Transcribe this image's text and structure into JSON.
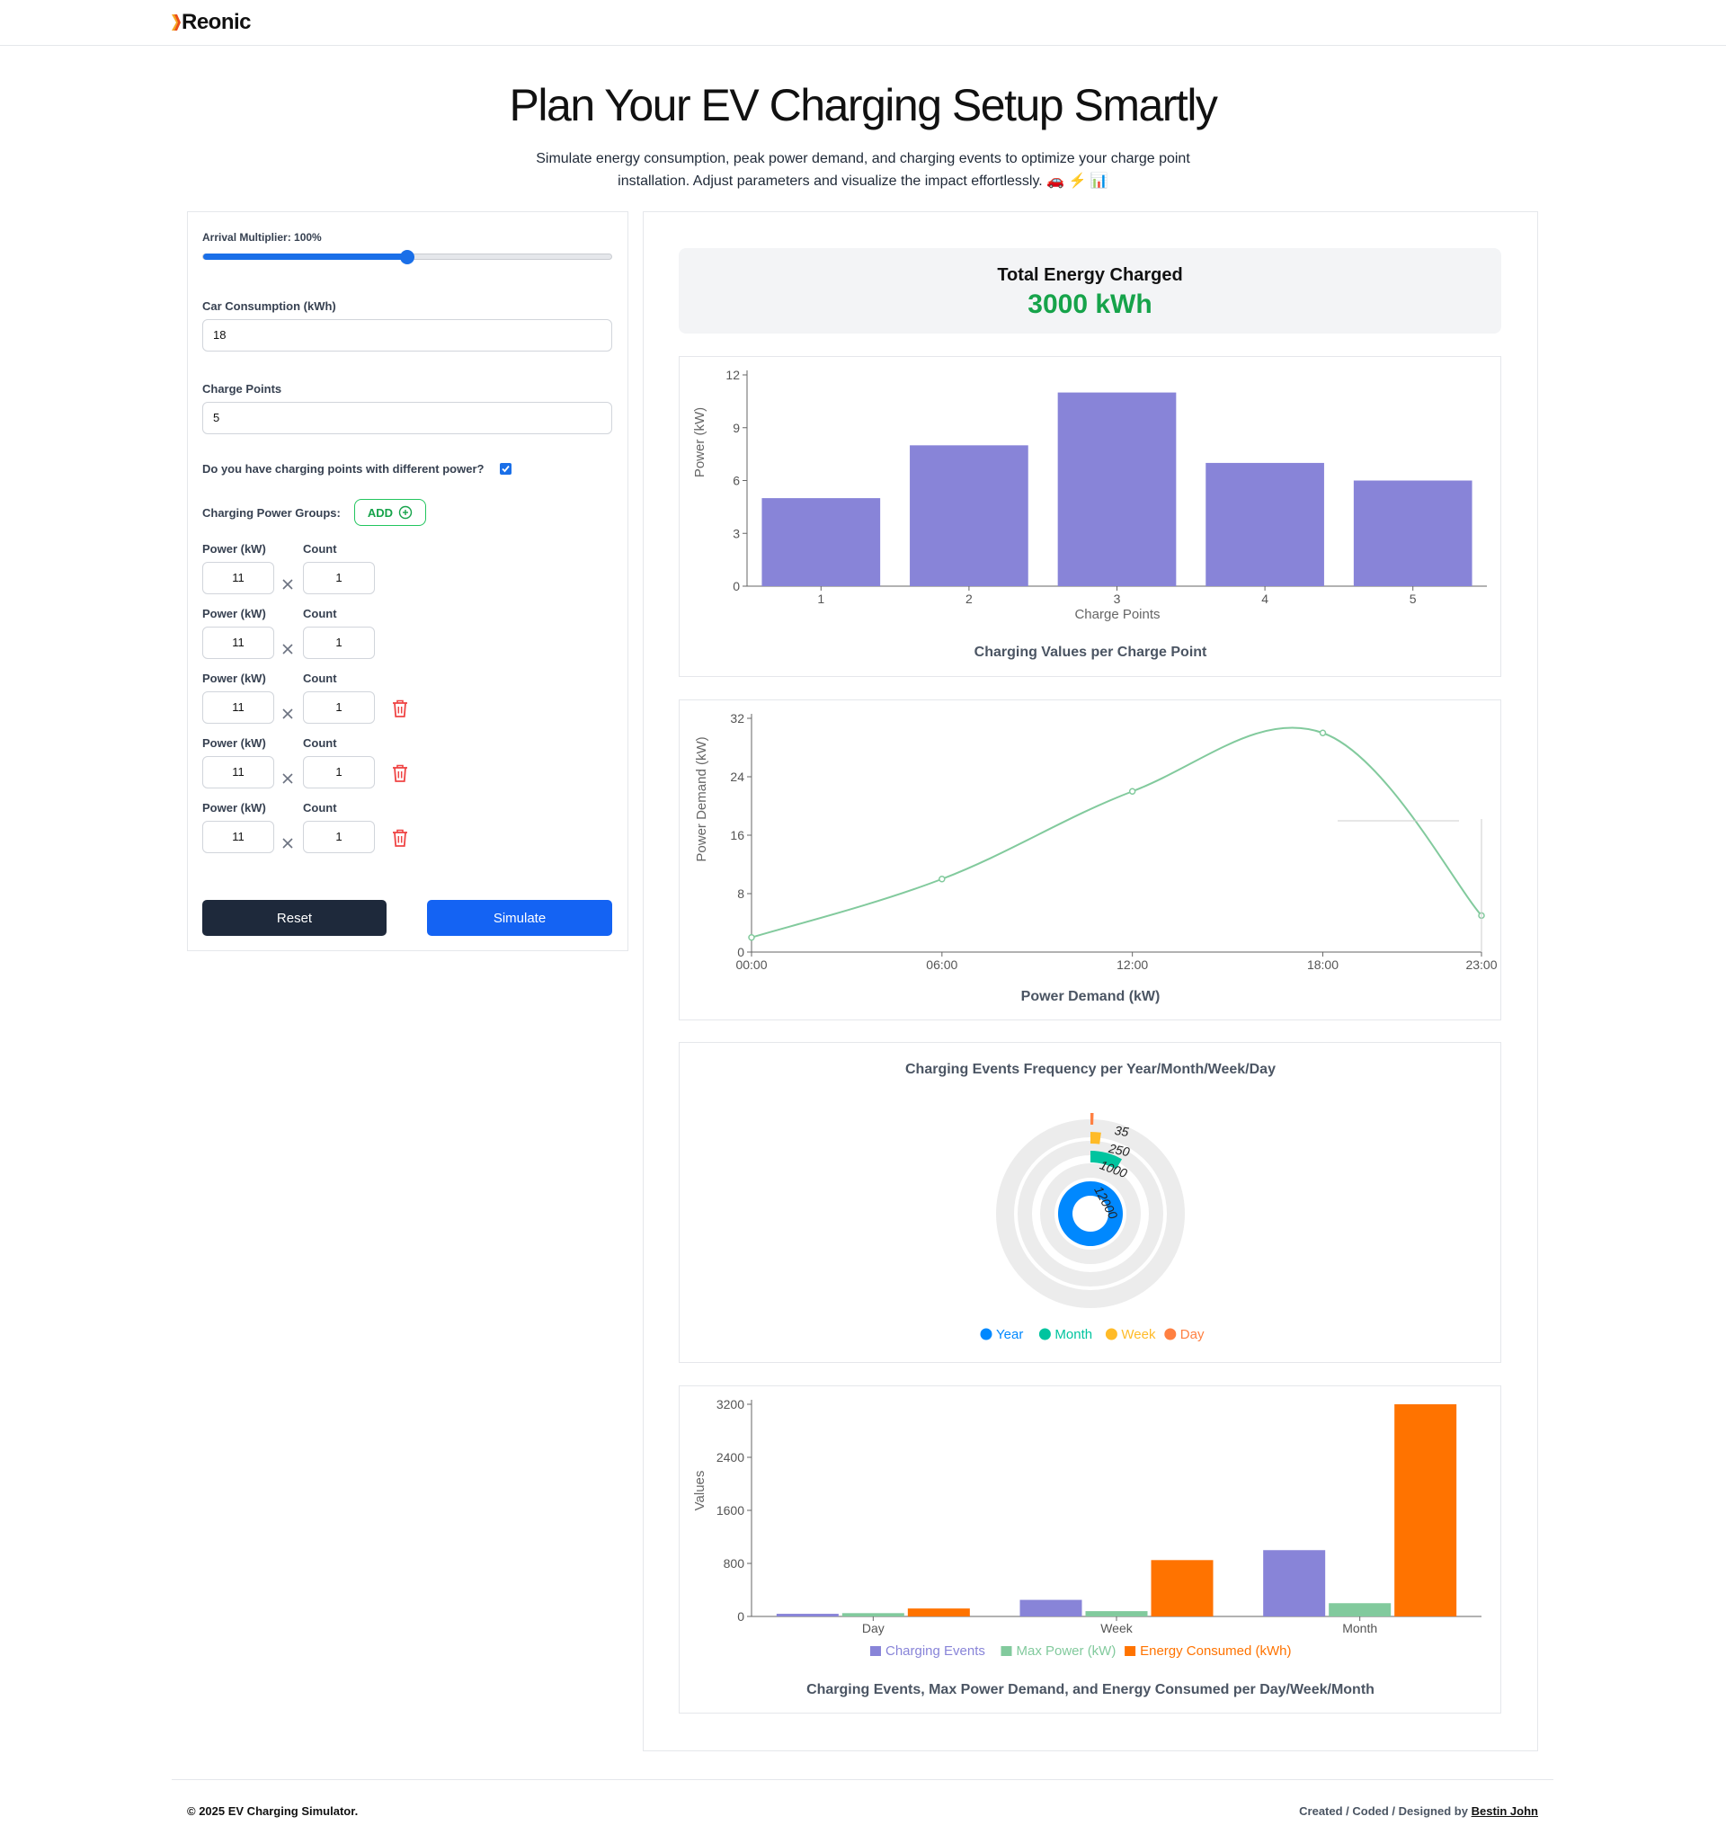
{
  "header": {
    "logo_text": "Reonic"
  },
  "hero": {
    "title": "Plan Your EV Charging Setup Smartly",
    "subtitle_line1": "Simulate energy consumption, peak power demand, and charging events to optimize your charge point",
    "subtitle_line2": "installation. Adjust parameters and visualize the impact effortlessly. 🚗 ⚡ 📊"
  },
  "form": {
    "arrival_label": "Arrival Multiplier: 100%",
    "arrival_value": 0.5,
    "consumption_label": "Car Consumption (kWh)",
    "consumption_value": "18",
    "charge_points_label": "Charge Points",
    "charge_points_value": "5",
    "different_power_label": "Do you have charging points with different power?",
    "different_power_checked": true,
    "groups_label": "Charging Power Groups:",
    "add_label": "ADD",
    "power_label": "Power (kW)",
    "count_label": "Count",
    "groups": [
      {
        "power": "11",
        "count": "1",
        "deletable": false
      },
      {
        "power": "11",
        "count": "1",
        "deletable": false
      },
      {
        "power": "11",
        "count": "1",
        "deletable": true
      },
      {
        "power": "11",
        "count": "1",
        "deletable": true
      },
      {
        "power": "11",
        "count": "1",
        "deletable": true
      }
    ],
    "reset_label": "Reset",
    "simulate_label": "Simulate"
  },
  "summary": {
    "title": "Total Energy Charged",
    "value": "3000 kWh"
  },
  "colors": {
    "purple": "#8884d8",
    "green": "#82ca9d",
    "orange": "#ff7300",
    "blue": "#0088fe",
    "teal": "#00c49f",
    "yellow": "#ffbb28",
    "coral": "#ff8042"
  },
  "chart_data": [
    {
      "type": "bar",
      "title": "Charging Values per Charge Point",
      "xlabel": "Charge Points",
      "ylabel": "Power (kW)",
      "categories": [
        "1",
        "2",
        "3",
        "4",
        "5"
      ],
      "values": [
        5,
        8,
        11,
        7,
        6
      ],
      "ylim": [
        0,
        12
      ],
      "yticks": [
        "0",
        "3",
        "6",
        "9",
        "12"
      ]
    },
    {
      "type": "line",
      "title": "Power Demand (kW)",
      "ylabel": "Power Demand (kW)",
      "x": [
        "00:00",
        "06:00",
        "12:00",
        "18:00",
        "23:00"
      ],
      "values": [
        2,
        10,
        22,
        30,
        5
      ],
      "ylim": [
        0,
        32
      ],
      "yticks": [
        "0",
        "8",
        "16",
        "24",
        "32"
      ]
    },
    {
      "type": "pie",
      "title": "Charging Events Frequency per Year/Month/Week/Day",
      "series": [
        {
          "name": "Year",
          "value": 12000
        },
        {
          "name": "Month",
          "value": 1000
        },
        {
          "name": "Week",
          "value": 250
        },
        {
          "name": "Day",
          "value": 35
        }
      ],
      "value_labels": [
        "12000",
        "1000",
        "250",
        "35"
      ]
    },
    {
      "type": "bar",
      "title": "Charging Events, Max Power Demand, and Energy Consumed per Day/Week/Month",
      "ylabel": "Values",
      "categories": [
        "Day",
        "Week",
        "Month"
      ],
      "series": [
        {
          "name": "Charging Events",
          "values": [
            40,
            250,
            1000
          ]
        },
        {
          "name": "Max Power (kW)",
          "values": [
            50,
            80,
            200
          ]
        },
        {
          "name": "Energy Consumed (kWh)",
          "values": [
            120,
            850,
            3200
          ]
        }
      ],
      "ylim": [
        0,
        3200
      ],
      "yticks": [
        "0",
        "800",
        "1600",
        "2400",
        "3200"
      ]
    }
  ],
  "footer": {
    "copyright": "© 2025 EV Charging Simulator.",
    "credit_prefix": "Created / Coded / Designed by",
    "credit_name": "Bestin John"
  }
}
